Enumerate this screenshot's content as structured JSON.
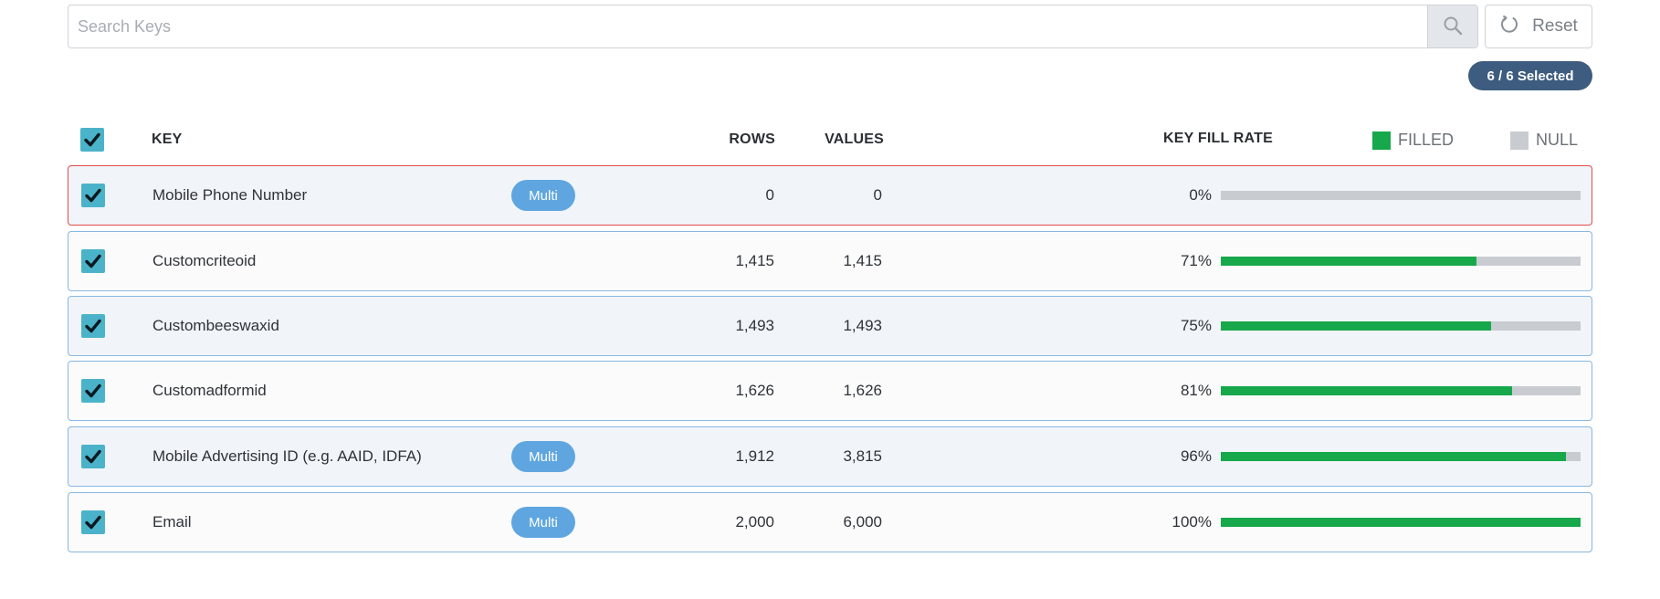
{
  "search": {
    "placeholder": "Search Keys",
    "value": ""
  },
  "reset": {
    "label": "Reset"
  },
  "selection_badge": "6 / 6 Selected",
  "header": {
    "key": "KEY",
    "rows": "ROWS",
    "values": "VALUES",
    "fill_rate": "KEY FILL RATE",
    "legend_filled": "FILLED",
    "legend_null": "NULL"
  },
  "colors": {
    "filled": "#16a84a",
    "null": "#c8ccd1",
    "checkbox": "#4bb3c9",
    "multi_badge": "#5fa6e0",
    "selected_badge": "#3d5c7f",
    "error_border": "#e14c4c",
    "row_border": "#89b7e3"
  },
  "rows": [
    {
      "key": "Mobile Phone Number",
      "badge": "Multi",
      "rows": "0",
      "values": "0",
      "fill_pct": "0%",
      "fill": 0.0,
      "checked": true,
      "error": true
    },
    {
      "key": "Customcriteoid",
      "badge": "",
      "rows": "1,415",
      "values": "1,415",
      "fill_pct": "71%",
      "fill": 0.71,
      "checked": true,
      "error": false
    },
    {
      "key": "Custombeeswaxid",
      "badge": "",
      "rows": "1,493",
      "values": "1,493",
      "fill_pct": "75%",
      "fill": 0.75,
      "checked": true,
      "error": false
    },
    {
      "key": "Customadformid",
      "badge": "",
      "rows": "1,626",
      "values": "1,626",
      "fill_pct": "81%",
      "fill": 0.81,
      "checked": true,
      "error": false
    },
    {
      "key": "Mobile Advertising ID (e.g. AAID, IDFA)",
      "badge": "Multi",
      "rows": "1,912",
      "values": "3,815",
      "fill_pct": "96%",
      "fill": 0.96,
      "checked": true,
      "error": false
    },
    {
      "key": "Email",
      "badge": "Multi",
      "rows": "2,000",
      "values": "6,000",
      "fill_pct": "100%",
      "fill": 1.0,
      "checked": true,
      "error": false
    }
  ]
}
